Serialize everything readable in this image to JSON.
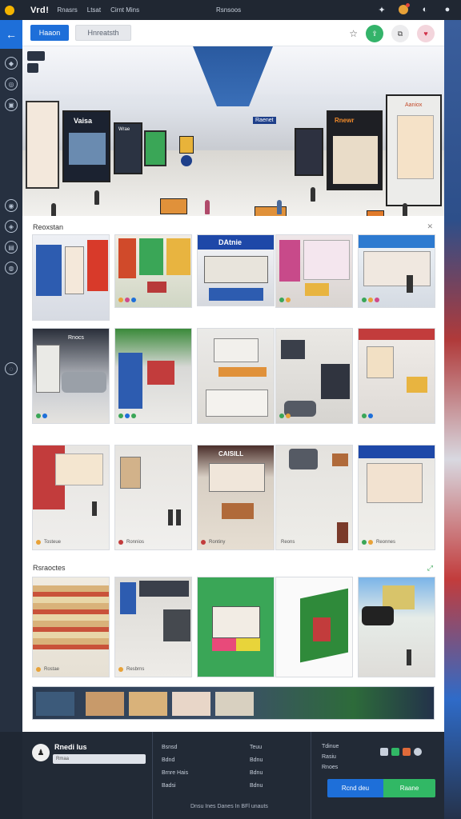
{
  "topbar": {
    "brand": "Vrd!",
    "menu": [
      "Rnasrs",
      "Ltsat",
      "Cirnt Mins"
    ],
    "center_title": "Rsnsoos"
  },
  "toolbar": {
    "primary_label": "Haaon",
    "secondary_label": "Hnreatsth"
  },
  "hero": {
    "store_signs": [
      "Vaisa",
      "Wrae",
      "Rnewr",
      "Aaniox"
    ],
    "center_sign": "Raenet"
  },
  "gallery": {
    "section1_title": "Reoxstan",
    "section2_title": "Rsraoctes",
    "tiles_row1": [
      {
        "sign": "",
        "caption": ""
      },
      {
        "sign": "",
        "caption": ""
      },
      {
        "sign": "DAtnie",
        "caption": ""
      },
      {
        "sign": "",
        "caption": ""
      },
      {
        "sign": "",
        "caption": ""
      }
    ],
    "tiles_row2": [
      {
        "sign": "Rnocs",
        "caption": ""
      },
      {
        "sign": "",
        "caption": ""
      },
      {
        "sign": "",
        "caption": ""
      },
      {
        "sign": "",
        "caption": ""
      },
      {
        "sign": "",
        "caption": ""
      }
    ],
    "tiles_row3": [
      {
        "sign": "",
        "caption": "Tosteue"
      },
      {
        "sign": "",
        "caption": "Ronnios"
      },
      {
        "sign": "CAISILL",
        "caption": "Rontiny"
      },
      {
        "sign": "",
        "caption": "Reons"
      },
      {
        "sign": "",
        "caption": "Reonnes"
      }
    ],
    "tiles_row4": [
      {
        "sign": "",
        "caption": "Rostae"
      },
      {
        "sign": "",
        "caption": "Resbrns"
      },
      {
        "sign": "",
        "caption": ""
      },
      {
        "sign": "",
        "caption": ""
      },
      {
        "sign": "",
        "caption": ""
      }
    ]
  },
  "footer": {
    "user_name": "Rnedi lus",
    "user_placeholder": "Rmaa",
    "col1": [
      "Bsnsd",
      "Bdnd",
      "Brnre Hais",
      "Badsi"
    ],
    "col2": [
      "Teuu",
      "Bdnu",
      "Bdnu",
      "Bdnu"
    ],
    "col3": [
      "Tdinue",
      "Rasiu",
      "Rnoes"
    ],
    "button_primary": "Rcnd deu",
    "button_secondary": "Raane",
    "copyright": "Dnsu Ines Danes In BFl unauts"
  },
  "colors": {
    "accent_blue": "#1e6fd9",
    "accent_green": "#31b865",
    "notification_orange": "#e8a238"
  },
  "icons": [
    "app-icon",
    "puzzle-icon",
    "notification-icon",
    "help-icon",
    "user-icon",
    "back-arrow-icon",
    "star-icon",
    "share-icon",
    "copy-icon",
    "heart-icon",
    "close-icon"
  ]
}
